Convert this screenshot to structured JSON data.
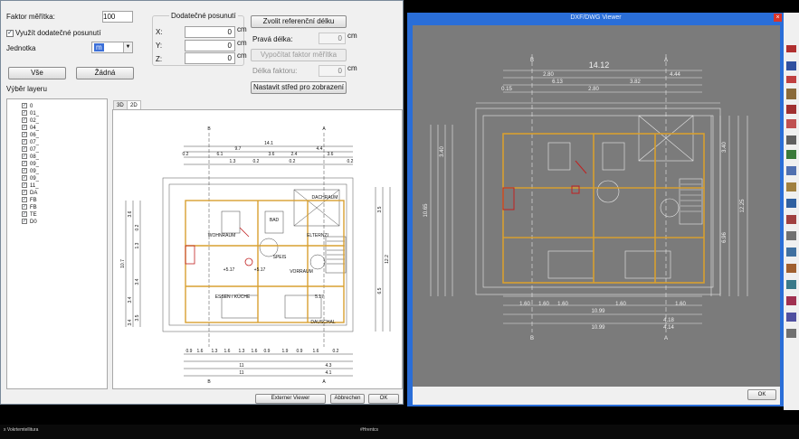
{
  "dialog": {
    "scale_factor_label": "Faktor měřítka:",
    "scale_factor_value": "100",
    "use_extra_offset_label": "Využít dodatečné posunutí",
    "use_extra_offset_checked": true,
    "unit_label": "Jednotka",
    "unit_value": "m",
    "all_button": "Vše",
    "none_button": "Žádná",
    "layer_selection_label": "Výběr layeru",
    "offset_group_title": "Dodatečné posunutí",
    "x_label": "X:",
    "x_value": "0",
    "x_unit": "cm",
    "y_label": "Y:",
    "y_value": "0",
    "y_unit": "cm",
    "z_label": "Z:",
    "z_value": "0",
    "z_unit": "cm",
    "choose_ref_button": "Zvolit referenční délku",
    "real_length_label": "Pravá délka:",
    "real_length_value": "0",
    "real_length_unit": "cm",
    "compute_factor_button": "Vypočítat faktor měřítka",
    "factor_length_label": "Délka faktoru:",
    "factor_length_value": "0",
    "factor_length_unit": "cm",
    "set_center_button": "Nastavit střed pro zobrazení",
    "tab_3d": "3D",
    "tab_2d": "2D",
    "external_viewer_button": "Externer Viewer",
    "cancel_button": "Abbrechen",
    "ok_button": "OK"
  },
  "layers": [
    "0",
    "01_",
    "02_",
    "04_",
    "06_",
    "07_",
    "07_",
    "08_",
    "09_",
    "09_",
    "09_",
    "11_",
    "DA",
    "FB",
    "FB",
    "TE",
    "D0"
  ],
  "preview": {
    "dims_top": [
      "14.1",
      "9.7",
      "4.4",
      "6.1",
      "3.6",
      "2.4",
      "3.6",
      "0.2",
      "0.2",
      "0.2",
      "0.2",
      "1.3"
    ],
    "dims_bottom": [
      "0.9",
      "1.6",
      "1.3",
      "1.6",
      "1.3",
      "1.6",
      "0.9",
      "1.9",
      "0.9",
      "1.6",
      "0.2",
      "4.3",
      "11",
      "11",
      "4.1"
    ],
    "dims_left": [
      "10.7",
      "3.6",
      "3.4",
      "0.2",
      "1.3",
      "3.4",
      "3.4",
      "3.5"
    ],
    "dims_right": [
      "12.2",
      "3.5",
      "6.5"
    ],
    "rooms": [
      "DACHRAUM",
      "BAD",
      "WOHNRAUM",
      "ELTERNZI",
      "SPEIS",
      "VORRAUM",
      "ESSEN / KÜCHE",
      "DAUSCHAL",
      "+5.17",
      "+5.17",
      "5.17"
    ],
    "axis_marks": [
      "B",
      "A",
      "B",
      "A"
    ]
  },
  "viewer": {
    "title": "DXF/DWG Viewer",
    "close_label": "×",
    "ok_button": "OK",
    "dims_top": [
      "14.12",
      "2.80",
      "4.44",
      "6.13",
      "3.82",
      "2.80",
      "0.15"
    ],
    "dims_bottom": [
      "10.99",
      "10.99",
      "4.18",
      "4.14",
      "1.60",
      "1.60",
      "1.60",
      "1.60",
      "1.60"
    ],
    "dims_left": [
      "10.65",
      "3.40"
    ],
    "dims_right": [
      "12.25",
      "3.40",
      "6.96"
    ],
    "axis_marks": [
      "B",
      "A",
      "B",
      "A"
    ]
  },
  "taskbar": {
    "left_text": "x Vokrtemtellitura",
    "mid_text": "#Hrentcs"
  },
  "colors": {
    "window_bg": "#f0f0f0",
    "viewer_frame": "#2a6ed8",
    "viewer_canvas": "#7b7b7b",
    "plan_wall": "#d8a030",
    "plan_red": "#c02020"
  }
}
